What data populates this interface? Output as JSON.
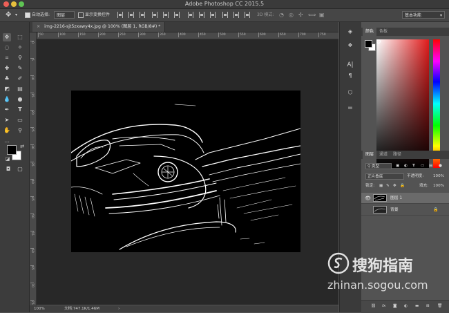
{
  "window": {
    "title": "Adobe Photoshop CC 2015.5"
  },
  "options_bar": {
    "auto_select_label": "自动选择:",
    "auto_select_value": "图层",
    "show_transform_label": "显示变换控件",
    "mode_3d_label": "3D 模式:",
    "workspace_value": "基本功能"
  },
  "document": {
    "tab_title": "img-2216-sjt5zxawy4x.jpg @ 100% (图层 1, RGB/8#) *",
    "close_glyph": "×"
  },
  "rulers": {
    "top_ticks": [
      "50",
      "100",
      "150",
      "200",
      "250",
      "300",
      "350",
      "400",
      "450",
      "500",
      "550",
      "600",
      "650",
      "700",
      "750"
    ],
    "left_ticks": [
      "0",
      "5",
      "10",
      "15",
      "20",
      "25",
      "30",
      "35",
      "40",
      "45",
      "50",
      "55",
      "60",
      "65",
      "70",
      "75"
    ]
  },
  "status_bar": {
    "zoom": "100%",
    "doc_info": "文档:747.1K/1.46M",
    "arrow": "›"
  },
  "color_panel": {
    "tab_color": "颜色",
    "tab_swatches": "色板"
  },
  "layers_panel": {
    "tabs": [
      "图层",
      "通道",
      "路径"
    ],
    "filter_label": "类型",
    "blend_mode": "正片叠底",
    "opacity_label": "不透明度:",
    "opacity_value": "100%",
    "lock_label": "锁定:",
    "fill_label": "填充:",
    "fill_value": "100%",
    "layers": [
      {
        "name": "图层 1",
        "visible": true,
        "active": true
      },
      {
        "name": "背景",
        "visible": false,
        "active": false,
        "locked": true
      }
    ],
    "footer_icons": [
      "link-icon",
      "fx-icon",
      "mask-icon",
      "adjustment-icon",
      "group-icon",
      "new-layer-icon",
      "trash-icon"
    ]
  },
  "watermark": {
    "brand": "搜狗指南",
    "url": "zhinan.sogou.com"
  },
  "colors": {
    "accent": "#4a90d9",
    "foreground": "#000000",
    "background": "#ffffff"
  }
}
